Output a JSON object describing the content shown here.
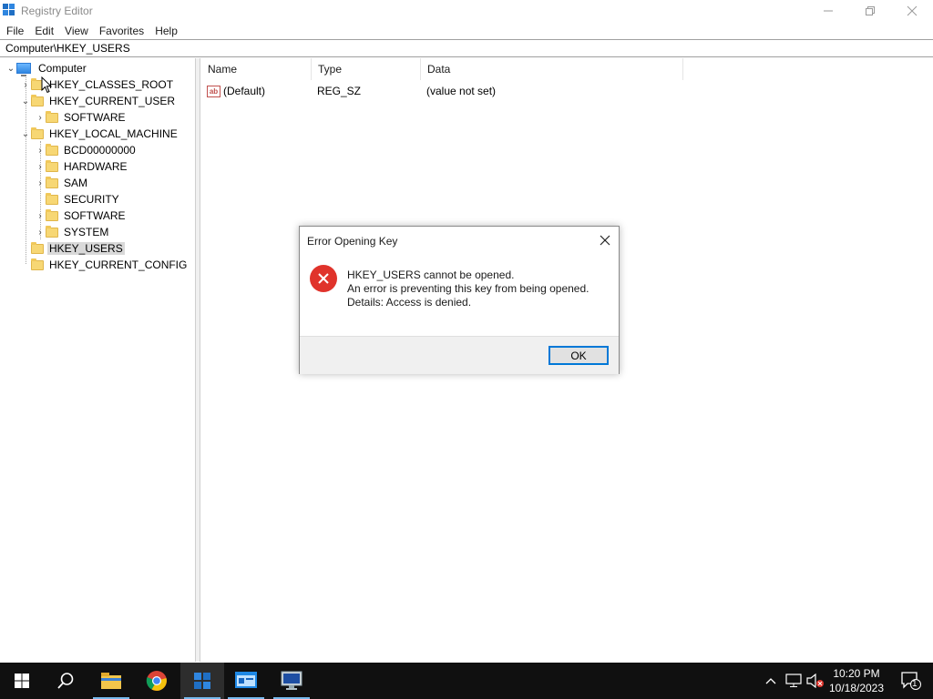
{
  "window": {
    "title": "Registry Editor"
  },
  "menu": {
    "items": [
      "File",
      "Edit",
      "View",
      "Favorites",
      "Help"
    ]
  },
  "address": {
    "path": "Computer\\HKEY_USERS"
  },
  "tree": {
    "root": "Computer",
    "hkey_classes_root": "HKEY_CLASSES_ROOT",
    "hkey_current_user": "HKEY_CURRENT_USER",
    "hkcu_software": "SOFTWARE",
    "hkey_local_machine": "HKEY_LOCAL_MACHINE",
    "hklm_children": [
      "BCD00000000",
      "HARDWARE",
      "SAM",
      "SECURITY",
      "SOFTWARE",
      "SYSTEM"
    ],
    "hkey_users": "HKEY_USERS",
    "hkey_current_config": "HKEY_CURRENT_CONFIG",
    "selected": "HKEY_USERS"
  },
  "values_pane": {
    "columns": [
      "Name",
      "Type",
      "Data"
    ],
    "rows": [
      {
        "name": "(Default)",
        "type": "REG_SZ",
        "data": "(value not set)",
        "icon": "string-value-icon"
      }
    ]
  },
  "dialog": {
    "title": "Error Opening Key",
    "line1": "HKEY_USERS cannot be opened.",
    "line2": "An error is preventing this key from being opened.",
    "line3": "Details: Access is denied.",
    "ok_label": "OK",
    "icon": "error-icon"
  },
  "taskbar": {
    "time": "10:20 PM",
    "date": "10/18/2023",
    "notification_count": "1"
  },
  "colors": {
    "accent": "#0078d7",
    "error": "#e0332b",
    "taskbar": "#101010",
    "folder": "#f7d774"
  }
}
